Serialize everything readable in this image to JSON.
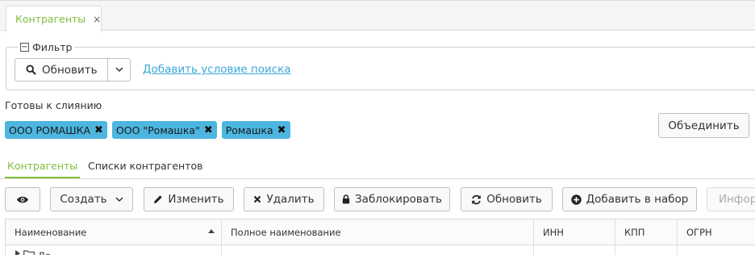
{
  "top_tab": {
    "label": "Контрагенты",
    "close": "×"
  },
  "filter": {
    "legend": "Фильтр",
    "refresh_label": "Обновить",
    "add_condition": "Добавить условие поиска"
  },
  "merge": {
    "title": "Готовы к слиянию",
    "chips": [
      "ООО РОМАШКА",
      "ООО \"Ромашка\"",
      "Ромашка"
    ],
    "merge_button": "Объединить"
  },
  "subtabs": {
    "active": "Контрагенты",
    "other": "Списки контрагентов"
  },
  "toolbar": {
    "create": "Создать",
    "edit": "Изменить",
    "delete": "Удалить",
    "lock": "Заблокировать",
    "refresh": "Обновить",
    "add_to_set": "Добавить в набор",
    "info": "Инфор"
  },
  "grid": {
    "columns": [
      "Наименование",
      "Полное наименование",
      "ИНН",
      "КПП",
      "ОГРН"
    ],
    "sorted_column": "Наименование",
    "sort_direction": "asc",
    "first_row_partial": "До"
  },
  "colors": {
    "accent_green": "#7fbf3f",
    "chip_blue": "#4cb6e0",
    "link_blue": "#3ba7d6"
  }
}
